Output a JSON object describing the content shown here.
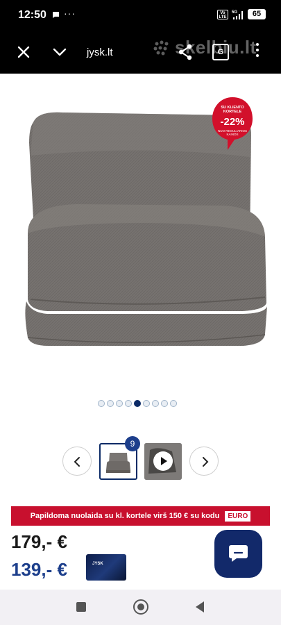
{
  "status_bar": {
    "time": "12:50",
    "dots": "···",
    "volte": "Vo LTE",
    "network": "5G",
    "battery": "65"
  },
  "browser": {
    "url": "jysk.lt",
    "watermark": "skelbiu.lt",
    "translate_label": "G"
  },
  "badge": {
    "top_text": "SU KLIENTO KORTELE",
    "percent": "-22%",
    "bottom_text": "NUO REGULIARIOS KAINOS"
  },
  "gallery": {
    "dot_count": 9,
    "active_index": 4,
    "image_count": "9"
  },
  "promo": {
    "text": "Papildoma nuolaida su kl. kortele virš 150 € su kodu",
    "code": "EURO"
  },
  "prices": {
    "old": "179,- €",
    "new": "139,- €"
  },
  "card": {
    "logo": "JYSK"
  },
  "colors": {
    "brand_blue": "#1d3f8c",
    "promo_red": "#c8102e",
    "badge_red": "#d2102b"
  }
}
